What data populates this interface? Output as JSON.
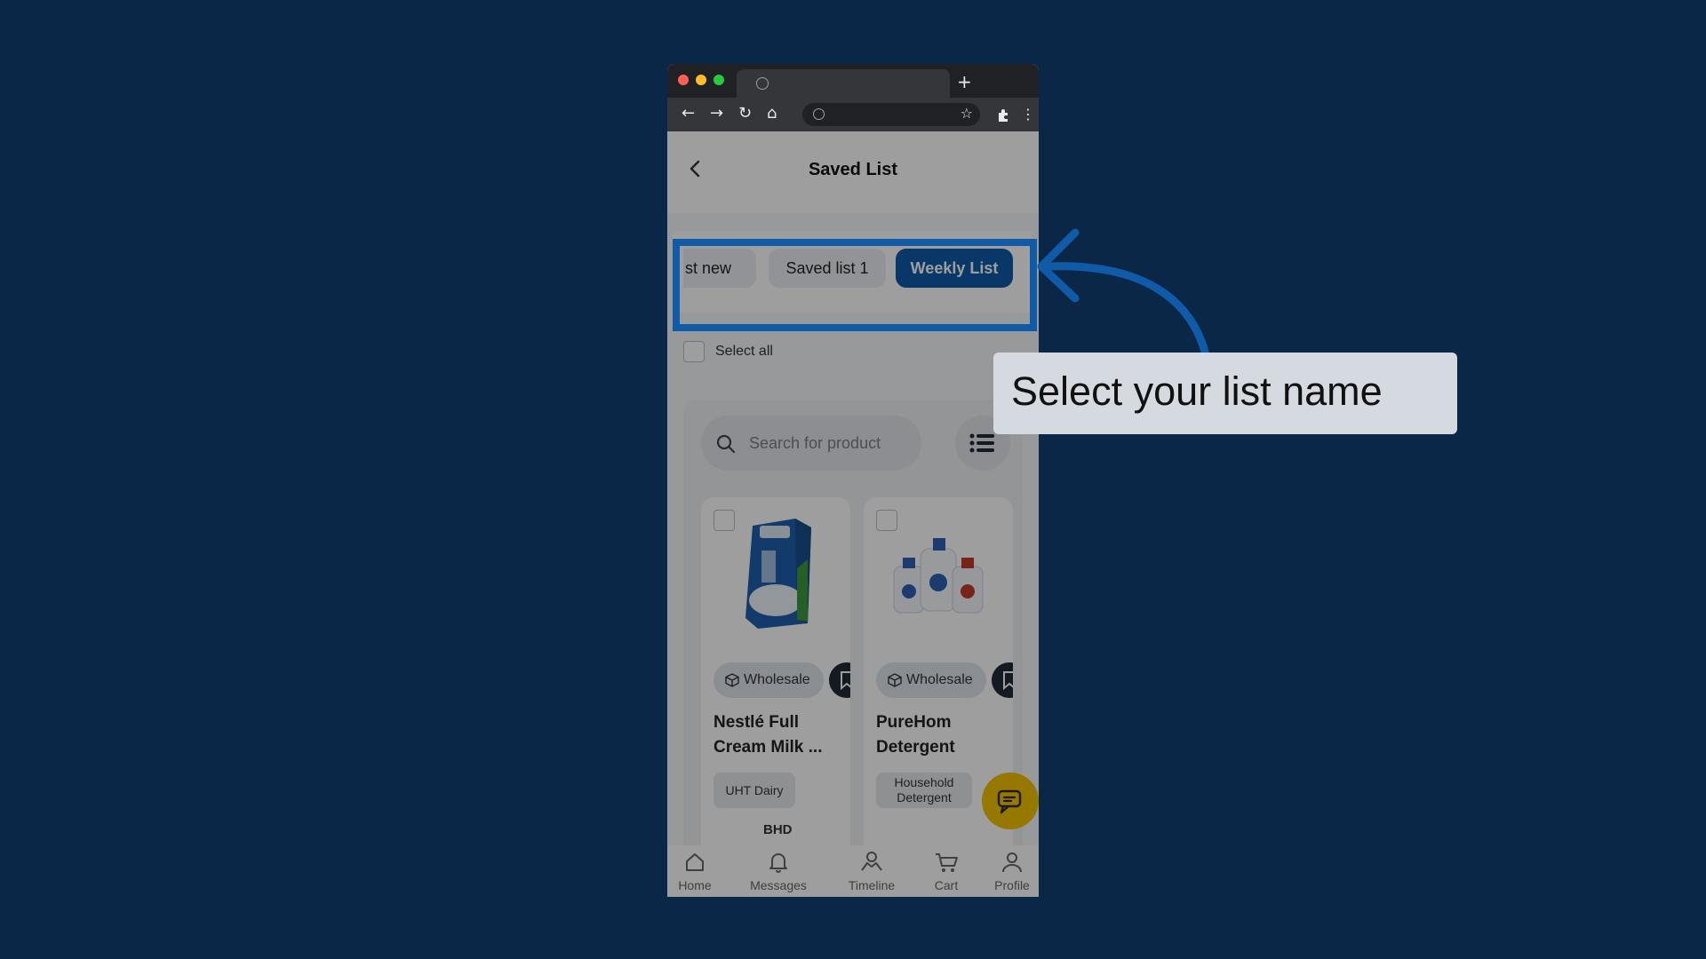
{
  "app": {
    "header": {
      "title": "Saved List"
    },
    "list_chips": [
      {
        "label": "st new"
      },
      {
        "label": "Saved list 1"
      },
      {
        "label": "Weekly List"
      }
    ],
    "select_all": {
      "label": "Select all"
    },
    "search": {
      "placeholder": "Search for product"
    },
    "products": [
      {
        "badge": "Wholesale",
        "name": "Nestlé Full Cream Milk ...",
        "name_line1": "Nestlé Full",
        "name_line2": "Cream Milk ...",
        "category": "UHT Dairy",
        "price_hint": "BHD"
      },
      {
        "badge": "Wholesale",
        "name_line1": "PureHom",
        "name_line2": "Detergent",
        "category_line1": "Household",
        "category_line2": "Detergent"
      }
    ],
    "bottom_nav": [
      {
        "label": "Home",
        "icon": "home-icon"
      },
      {
        "label": "Messages",
        "icon": "bell-icon"
      },
      {
        "label": "Timeline",
        "icon": "timeline-icon"
      },
      {
        "label": "Cart",
        "icon": "cart-icon"
      },
      {
        "label": "Profile",
        "icon": "profile-icon"
      }
    ]
  },
  "annotation": {
    "tooltip": "Select your list name",
    "highlight_color": "#0f5ba8"
  },
  "colors": {
    "background": "#0b2748",
    "accent": "#0f5ba8",
    "fab": "#f2c200"
  }
}
